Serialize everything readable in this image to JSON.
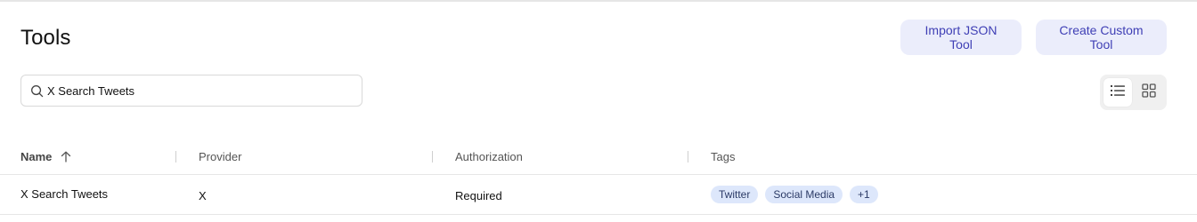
{
  "page": {
    "title": "Tools"
  },
  "actions": {
    "import_label": "Import JSON Tool",
    "create_label": "Create Custom Tool"
  },
  "search": {
    "value": "X Search Tweets",
    "icon": "search-icon"
  },
  "view_toggle": {
    "selected": "list",
    "options": [
      "list",
      "grid"
    ]
  },
  "table": {
    "columns": [
      "Name",
      "Provider",
      "Authorization",
      "Tags"
    ],
    "sort": {
      "column": "Name",
      "direction": "ascending"
    },
    "rows": [
      {
        "name": "X Search Tweets",
        "provider": "X",
        "authorization": "Required",
        "tags": [
          "Twitter",
          "Social Media",
          "+1"
        ]
      }
    ]
  },
  "colors": {
    "button_bg": "#ebedfb",
    "button_text": "#3f3fb5",
    "tag_bg": "#dde7fb",
    "tag_text": "#2b3a66"
  }
}
